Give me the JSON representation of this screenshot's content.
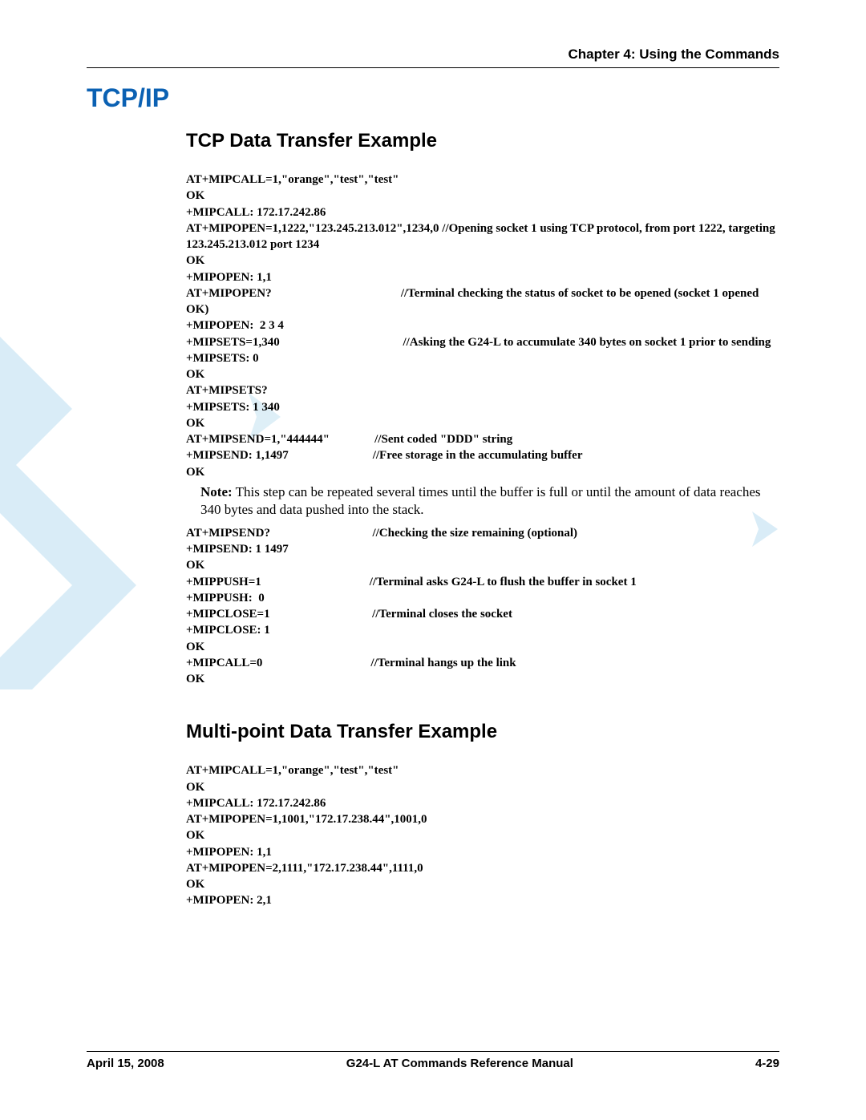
{
  "header": {
    "chapter": "Chapter 4:  Using the Commands"
  },
  "title": "TCP/IP",
  "section1": {
    "heading": "TCP Data Transfer Example",
    "code_part1": "AT+MIPCALL=1,\"orange\",\"test\",\"test\"\nOK\n+MIPCALL: 172.17.242.86\nAT+MIPOPEN=1,1222,\"123.245.213.012\",1234,0 //Opening socket 1 using TCP protocol, from port 1222, targeting 123.245.213.012 port 1234\nOK\n+MIPOPEN: 1,1\nAT+MIPOPEN?                                           //Terminal checking the status of socket to be opened (socket 1 opened OK)\n+MIPOPEN:  2 3 4\n+MIPSETS=1,340                                         //Asking the G24-L to accumulate 340 bytes on socket 1 prior to sending\n+MIPSETS: 0\nOK\nAT+MIPSETS?\n+MIPSETS: 1 340\nOK\nAT+MIPSEND=1,\"444444\"               //Sent coded \"DDD\" string\n+MIPSEND: 1,1497                            //Free storage in the accumulating buffer\nOK",
    "note_label": "Note:",
    "note_text": "This step can be repeated several times until the buffer is full or until the amount of data reaches 340 bytes and data pushed into the stack.",
    "code_part2": "AT+MIPSEND?                                  //Checking the size remaining (optional)\n+MIPSEND: 1 1497\nOK\n+MIPPUSH=1                                    //Terminal asks G24-L to flush the buffer in socket 1\n+MIPPUSH:  0\n+MIPCLOSE=1                                  //Terminal closes the socket\n+MIPCLOSE: 1\nOK\n+MIPCALL=0                                    //Terminal hangs up the link\nOK"
  },
  "section2": {
    "heading": "Multi-point Data Transfer Example",
    "code": "AT+MIPCALL=1,\"orange\",\"test\",\"test\"\nOK\n+MIPCALL: 172.17.242.86\nAT+MIPOPEN=1,1001,\"172.17.238.44\",1001,0\nOK\n+MIPOPEN: 1,1\nAT+MIPOPEN=2,1111,\"172.17.238.44\",1111,0\nOK\n+MIPOPEN: 2,1"
  },
  "footer": {
    "date": "April 15, 2008",
    "manual": "G24-L AT Commands Reference Manual",
    "page": "4-29"
  }
}
